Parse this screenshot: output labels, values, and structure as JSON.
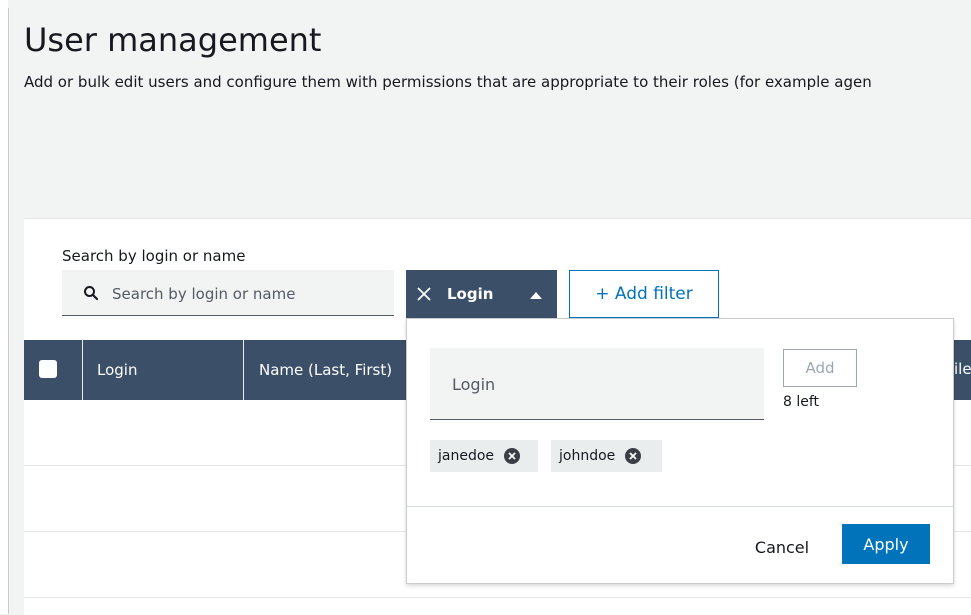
{
  "page": {
    "title": "User management",
    "description": "Add or bulk edit users and configure them with permissions that are appropriate to their roles (for example agen"
  },
  "search": {
    "label": "Search by login or name",
    "placeholder": "Search by login or name",
    "value": ""
  },
  "filter_chip": {
    "label": "Login",
    "close_icon": "close-icon",
    "caret_icon": "caret-up-icon"
  },
  "add_filter": {
    "label": "+ Add filter"
  },
  "table": {
    "columns": [
      "Login",
      "Name (Last, First)"
    ],
    "clipped_column_fragment": "ile"
  },
  "popover": {
    "input_placeholder": "Login",
    "add_label": "Add",
    "remaining": "8 left",
    "tokens": [
      "janedoe",
      "johndoe"
    ],
    "cancel_label": "Cancel",
    "apply_label": "Apply"
  },
  "colors": {
    "header_bg": "#3b5068",
    "accent": "#0073bb",
    "page_bg": "#f2f3f3"
  }
}
